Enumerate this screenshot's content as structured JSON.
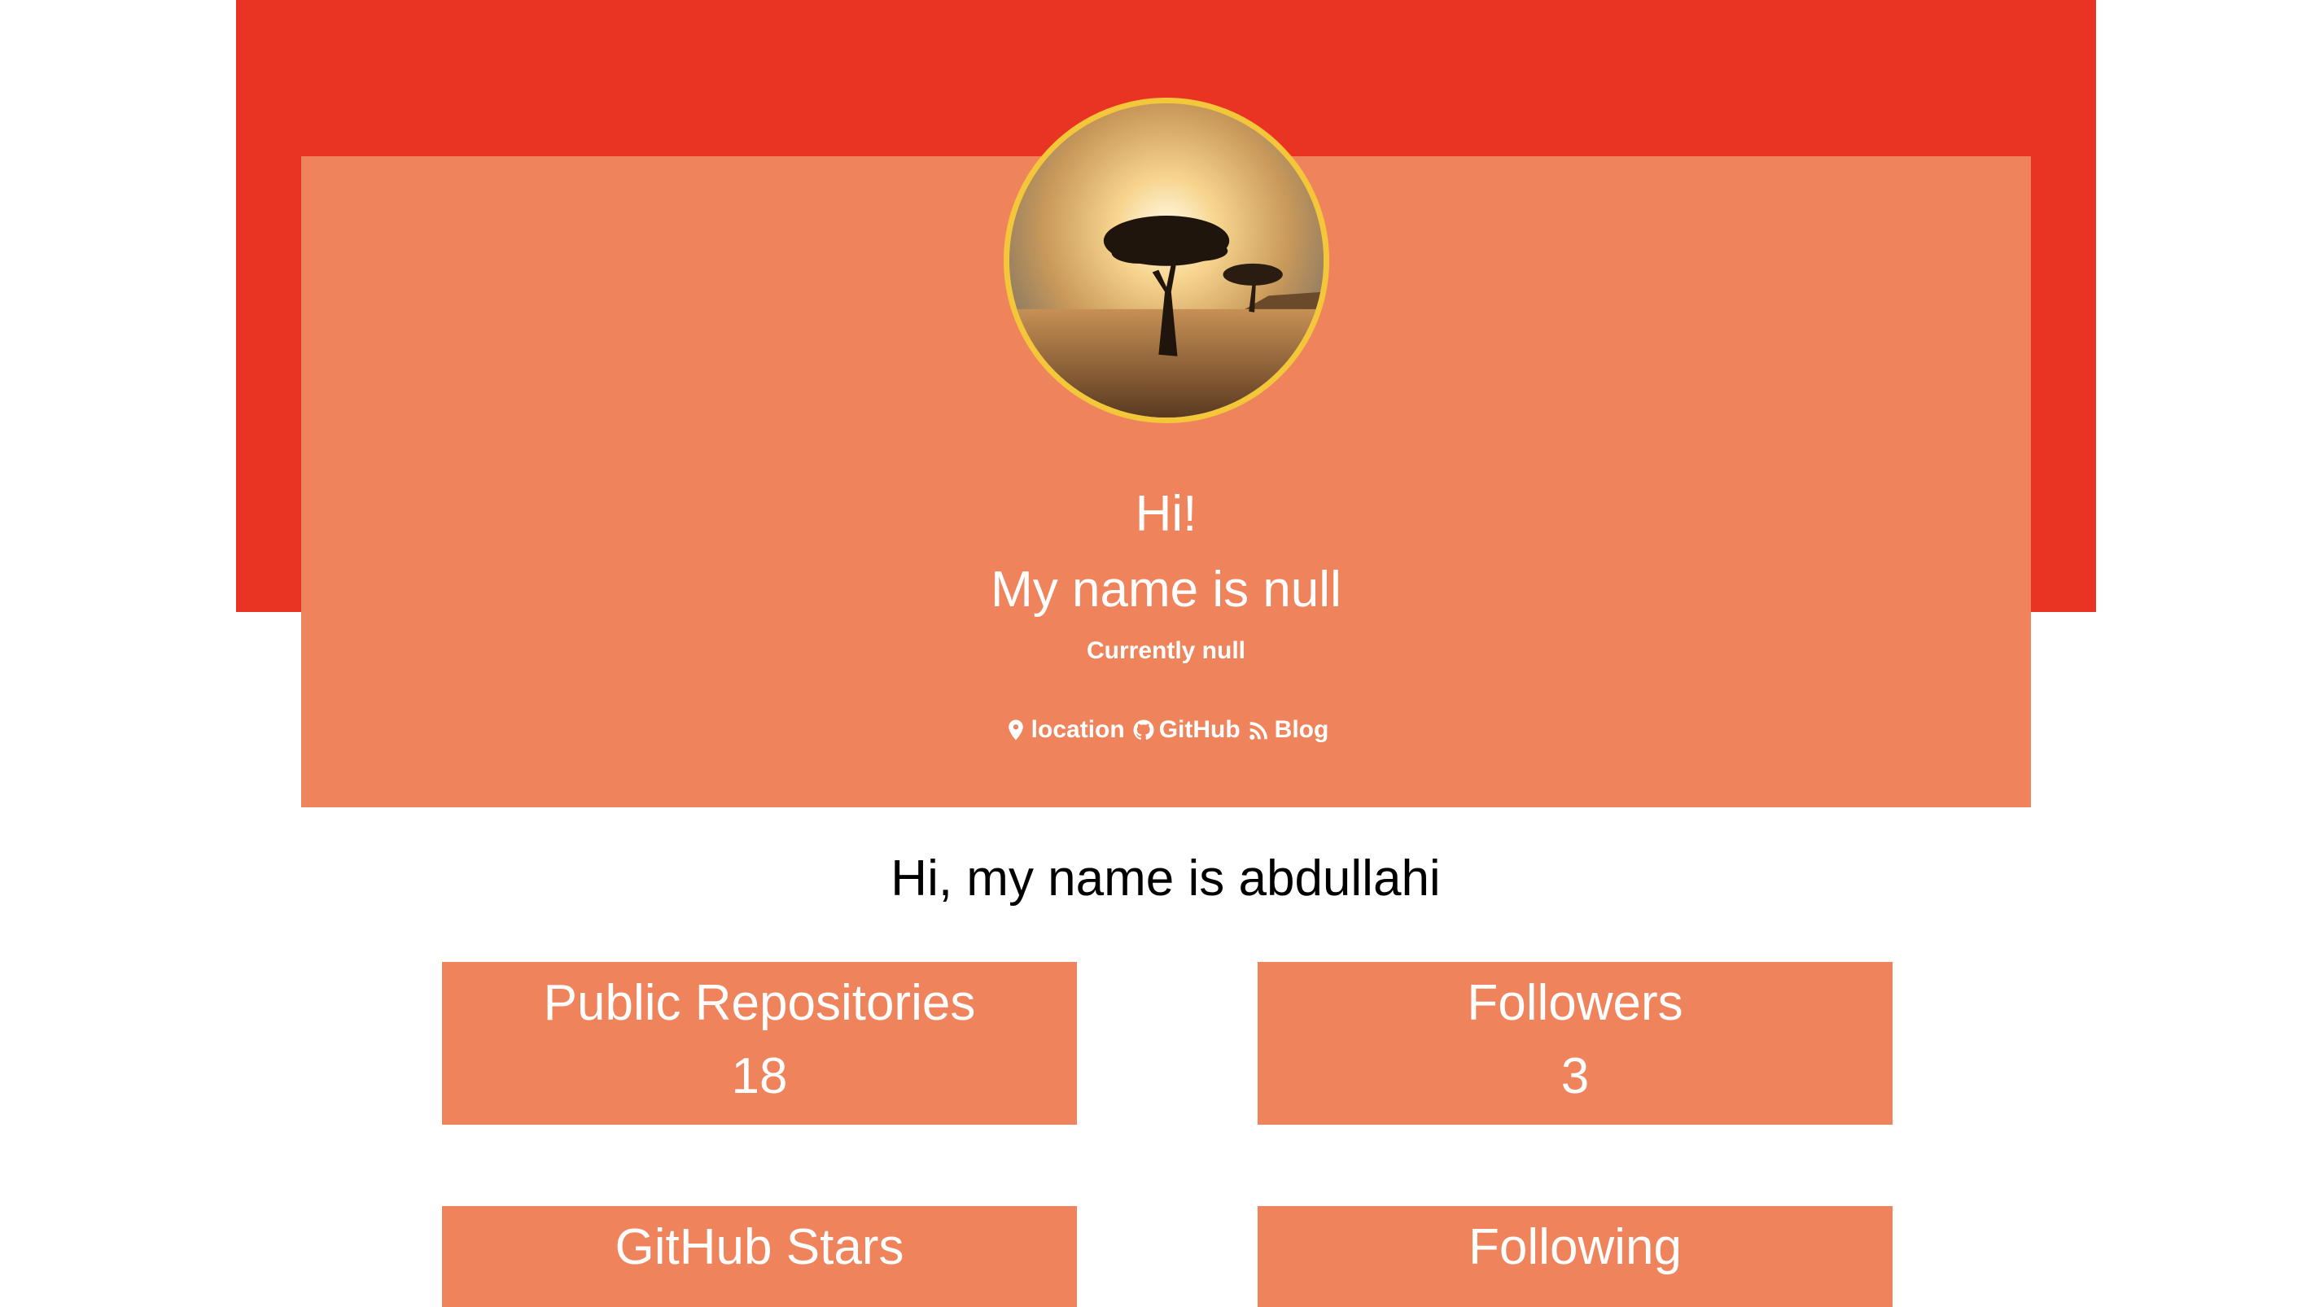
{
  "hero": {
    "greeting": "Hi!",
    "name_line": "My name is null",
    "status_line": "Currently null",
    "links": [
      {
        "icon": "map-pin-icon",
        "label": "location"
      },
      {
        "icon": "github-icon",
        "label": "GitHub"
      },
      {
        "icon": "rss-icon",
        "label": "Blog"
      }
    ]
  },
  "intro": "Hi, my name is abdullahi",
  "stats": [
    {
      "label": "Public Repositories",
      "value": "18"
    },
    {
      "label": "Followers",
      "value": "3"
    },
    {
      "label": "GitHub Stars",
      "value": ""
    },
    {
      "label": "Following",
      "value": ""
    }
  ],
  "colors": {
    "banner": "#e93323",
    "card": "#ef845c",
    "avatar_border": "#f4c63a"
  }
}
